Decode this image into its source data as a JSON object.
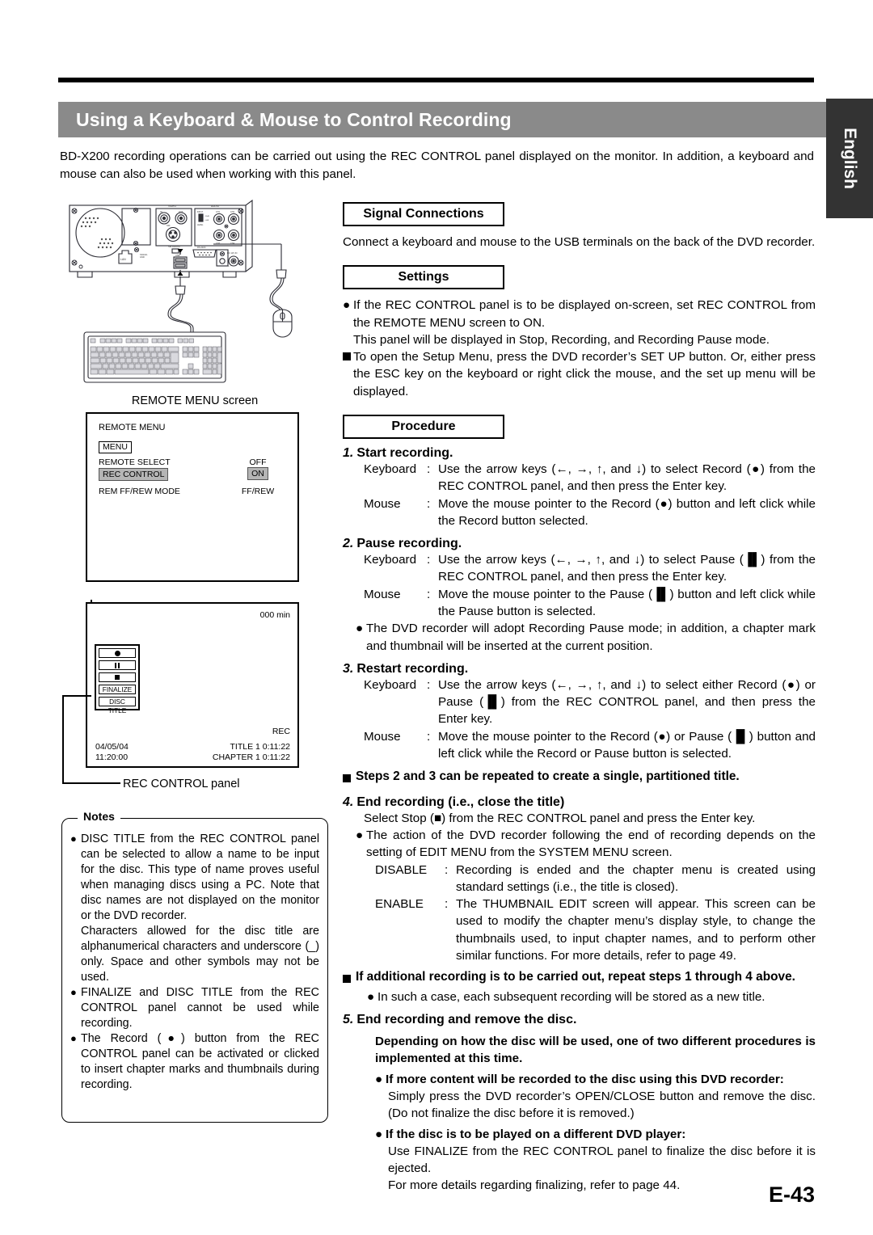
{
  "header": {
    "title": "Using a Keyboard & Mouse to Control Recording",
    "language_tab": "English",
    "intro": "BD-X200 recording operations can be carried out using the REC CONTROL panel displayed on the monitor. In addition, a keyboard and mouse can also be used when working with this panel."
  },
  "footer": {
    "page_number": "E-43"
  },
  "figures": {
    "rear_panel_caption": "REMOTE MENU screen",
    "rec_panel_caption": "REC CONTROL panel",
    "remote_menu_screen": {
      "header": "REMOTE MENU",
      "menu_tag": "MENU",
      "rows": [
        {
          "label": "REMOTE SELECT",
          "value": "OFF",
          "highlighted": false
        },
        {
          "label": "REC CONTROL",
          "value": "ON",
          "highlighted": true
        },
        {
          "label": "REM FF/REW MODE",
          "value": "FF/REW",
          "highlighted": false
        }
      ]
    },
    "rec_control_screen": {
      "minutes": "000 min",
      "rec_flag": "REC",
      "date": "04/05/04",
      "time": "11:20:00",
      "title_line": "TITLE 1   0:11:22",
      "chapter_line": "CHAPTER 1   0:11:22",
      "buttons": [
        {
          "icon": "record-icon",
          "label": ""
        },
        {
          "icon": "pause-icon",
          "label": ""
        },
        {
          "icon": "stop-icon",
          "label": ""
        }
      ],
      "text_buttons": [
        "FINALIZE",
        "DISC TITLE"
      ]
    }
  },
  "notes": {
    "label": "Notes",
    "items": [
      "DISC TITLE from the REC CONTROL panel can be selected to allow a name to be input for the disc. This type of name proves useful when managing discs using a PC. Note that disc names are not displayed on the monitor or the DVD recorder.",
      "FINALIZE and DISC TITLE from the REC CONTROL panel cannot be used while recording.",
      "The Record (●) button from the REC CONTROL panel can be activated or clicked to insert chapter marks and thumbnails during recording."
    ],
    "item1_continuation": "Characters allowed for the disc title are alphanumerical characters and underscore (_) only. Space and other symbols may not be used."
  },
  "sections": {
    "signal_connections": {
      "heading": "Signal Connections",
      "body": "Connect a keyboard and mouse to the USB terminals on the back of the DVD recorder."
    },
    "settings": {
      "heading": "Settings",
      "bullet1": "If the REC CONTROL panel is to be displayed on-screen, set REC CONTROL from the REMOTE MENU screen to ON.",
      "bullet1_cont": "This panel will be displayed in Stop, Recording, and Recording Pause mode.",
      "square1": "To open the Setup Menu, press the DVD recorder’s SET UP button. Or, either press the ESC key on the keyboard or right click the mouse, and the set up menu will be displayed."
    },
    "procedure": {
      "heading": "Procedure",
      "steps": [
        {
          "num": "1.",
          "title": "Start recording.",
          "keyboard_label": "Keyboard",
          "keyboard_text": "Use the arrow keys (←, →, ↑, and ↓) to select Record (●) from the REC CONTROL panel, and then press the Enter key.",
          "mouse_label": "Mouse",
          "mouse_text": "Move the mouse pointer to the Record (●) button and left click while the Record button selected."
        },
        {
          "num": "2.",
          "title": "Pause recording.",
          "keyboard_label": "Keyboard",
          "keyboard_text": "Use the arrow keys (←, →, ↑, and ↓) to select Pause (▐▌) from the REC CONTROL panel, and then press the Enter key.",
          "mouse_label": "Mouse",
          "mouse_text": "Move the mouse pointer to the Pause (▐▌) button and left click while the Pause button is selected.",
          "note": "The DVD recorder will adopt Recording Pause mode; in addition, a chapter mark and thumbnail will be inserted at the current position."
        },
        {
          "num": "3.",
          "title": "Restart recording.",
          "keyboard_label": "Keyboard",
          "keyboard_text": "Use the arrow keys (←, →, ↑, and ↓) to select either Record (●) or Pause (▐▌) from the REC CONTROL panel, and then press the Enter key.",
          "mouse_label": "Mouse",
          "mouse_text": "Move the mouse pointer to the Record (●) or Pause (▐▌) button and left click while the Record or Pause button is selected."
        }
      ],
      "steps_note": "Steps 2 and 3 can be repeated to create a single, partitioned title.",
      "step4": {
        "num": "4.",
        "title": "End recording (i.e., close the title)",
        "line1": "Select Stop (■) from the REC CONTROL panel and press the Enter key.",
        "bullet": "The action of the DVD recorder following the end of recording depends on the setting of EDIT MENU from the SYSTEM MENU screen.",
        "disable_label": "DISABLE",
        "disable_text": "Recording is ended and the chapter menu is created using standard settings (i.e., the title is closed).",
        "enable_label": "ENABLE",
        "enable_text": "The THUMBNAIL EDIT screen will appear. This screen can be used to modify the chapter menu’s display style, to change the thumbnails used, to input chapter names, and to perform other similar functions. For more details, refer to page 49."
      },
      "additional_note": "If additional recording is to be carried out, repeat steps 1 through 4 above.",
      "additional_sub": "In such a case, each subsequent recording will be stored as a new title.",
      "step5": {
        "num": "5.",
        "title": "End recording and remove the disc.",
        "lead": "Depending on how the disc will be used, one of two different procedures is implemented at this time.",
        "case1_head": "If more content will be recorded to the disc using this DVD recorder:",
        "case1_body": "Simply press the DVD recorder’s OPEN/CLOSE button and remove the disc. (Do not finalize the disc before it is removed.)",
        "case2_head": "If the disc is to be played on a different DVD player:",
        "case2_body": "Use FINALIZE from the REC CONTROL panel to finalize the disc before it is ejected.",
        "case2_body2": "For more details regarding finalizing, refer to page 44."
      }
    }
  }
}
